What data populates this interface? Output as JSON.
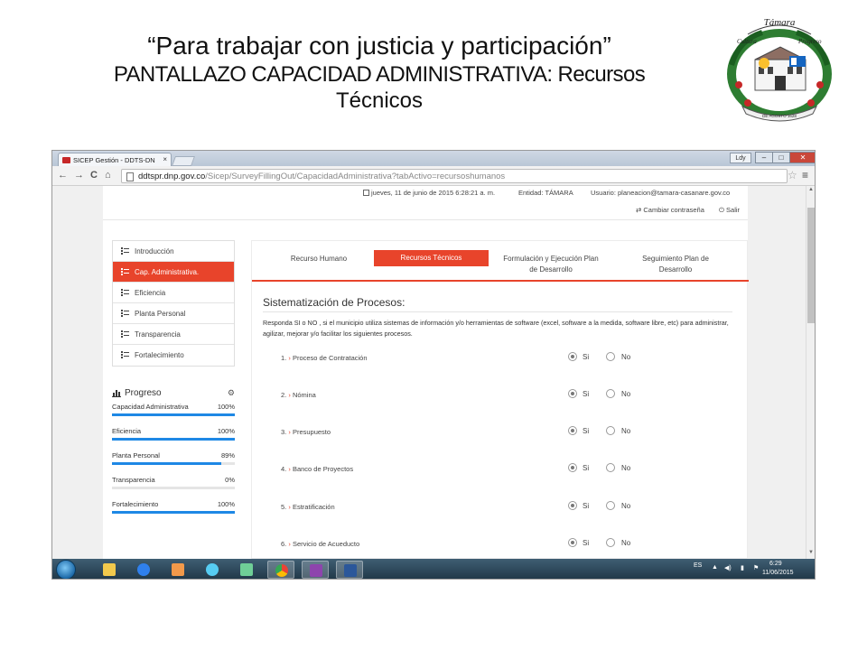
{
  "slide": {
    "title_line1": "“Para trabajar con justicia y participación”",
    "title_line2": "PANTALLAZO CAPACIDAD ADMINISTRATIVA: Recursos",
    "title_line3": "Técnicos",
    "seal_text_top": "Támara",
    "seal_text_left": "Cultura",
    "seal_text_right": "Progreso",
    "seal_ribbon": "DE AGOSTO 1628"
  },
  "browser": {
    "tab_title": "SICEP Gestión - DDTS-DN",
    "tab_close": "×",
    "user_button": "Ldy",
    "minimize": "–",
    "maximize": "□",
    "close": "✕",
    "back_icon": "←",
    "forward_icon": "→",
    "reload_icon": "C",
    "home_icon": "⌂",
    "url_host": "ddtspr.dnp.gov.co",
    "url_path": "/Sicep/SurveyFillingOut/CapacidadAdministrativa?tabActivo=recursoshumanos",
    "star_icon": "☆",
    "menu_icon": "≡"
  },
  "header": {
    "date": "jueves, 11 de junio de 2015 6:28:21 a. m.",
    "entidad": "Entidad: TÁMARA",
    "usuario": "Usuario: planeacion@tamara-casanare.gov.co",
    "change_password": "⇄ Cambiar contraseña",
    "logout": "⏻ Salir"
  },
  "sidebar": {
    "items": [
      {
        "label": "Introducción",
        "active": false
      },
      {
        "label": "Cap. Administrativa.",
        "active": true
      },
      {
        "label": "Eficiencia",
        "active": false
      },
      {
        "label": "Planta Personal",
        "active": false
      },
      {
        "label": "Transparencia",
        "active": false
      },
      {
        "label": "Fortalecimiento",
        "active": false
      }
    ]
  },
  "progress": {
    "title": "Progreso",
    "gear_icon": "⚙",
    "rows": [
      {
        "label": "Capacidad Administrativa",
        "pct_text": "100%",
        "value": 100
      },
      {
        "label": "Eficiencia",
        "pct_text": "100%",
        "value": 100
      },
      {
        "label": "Planta Personal",
        "pct_text": "89%",
        "value": 89
      },
      {
        "label": "Transparencia",
        "pct_text": "0%",
        "value": 0
      },
      {
        "label": "Fortalecimiento",
        "pct_text": "100%",
        "value": 100
      }
    ]
  },
  "tabs": {
    "t1": "Recurso Humano",
    "t2": "Recursos Técnicos",
    "t3a": "Formulación y Ejecución Plan",
    "t3b": "de Desarrollo",
    "t4a": "Seguimiento Plan de",
    "t4b": "Desarrollo"
  },
  "section": {
    "title": "Sistematización de Procesos:",
    "instructions": "Responda SI o NO , si el municipio utiliza sistemas de información y/o herramientas de software (excel, software a la medida, software libre, etc) para administrar, agilizar, mejorar y/o facilitar los siguientes procesos.",
    "yes_label": "Si",
    "no_label": "No",
    "questions": [
      {
        "num": "1.",
        "text": "Proceso de Contratación",
        "answer": "si"
      },
      {
        "num": "2.",
        "text": "Nómina",
        "answer": "si"
      },
      {
        "num": "3.",
        "text": "Presupuesto",
        "answer": "si"
      },
      {
        "num": "4.",
        "text": "Banco de Proyectos",
        "answer": "si"
      },
      {
        "num": "5.",
        "text": "Estratificación",
        "answer": "si"
      },
      {
        "num": "6.",
        "text": "Servicio de Acueducto",
        "answer": "si"
      }
    ]
  },
  "taskbar": {
    "lang": "ES",
    "time": "6:29",
    "date": "11/06/2015"
  },
  "colors": {
    "accent": "#e8442b",
    "progress_bar": "#1e88e5"
  }
}
